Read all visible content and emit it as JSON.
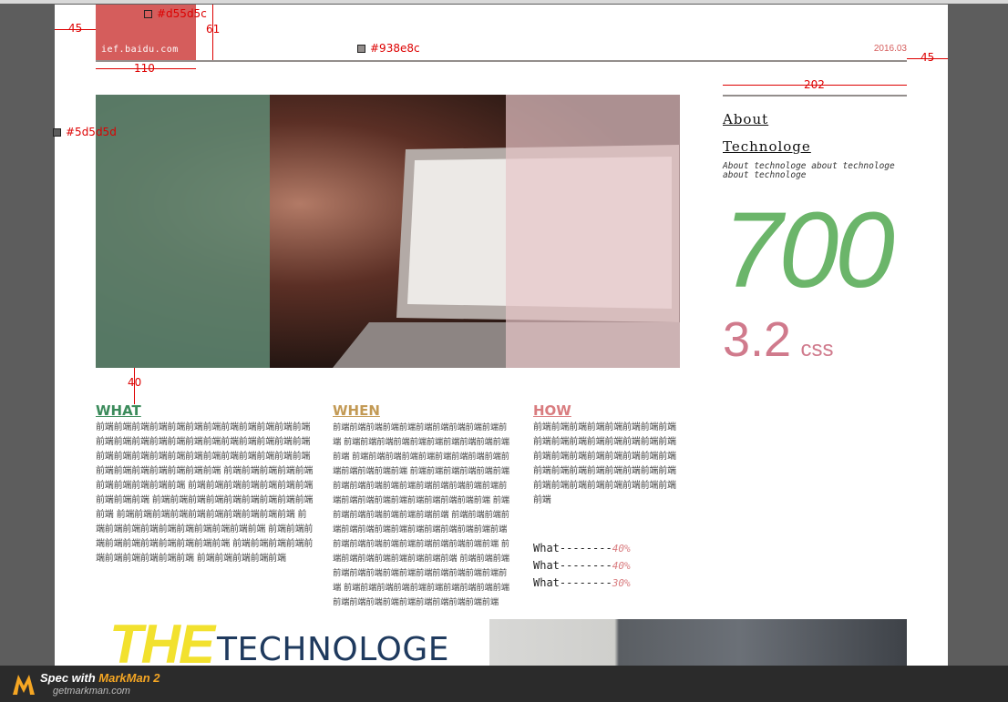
{
  "header": {
    "logo_url": "ief.baidu.com",
    "date": "2016.03"
  },
  "sidebar": {
    "title_line1": "About",
    "title_line2": "Technologe",
    "subtitle": "About technologe about technologe about technologe",
    "big_number": "700",
    "version_number": "3.2",
    "version_unit": "css"
  },
  "columns": [
    {
      "heading": "WHAT",
      "body": "前端前端前端前端前端前端前端前端前端前端前端前端前端前端前端前端前端前端前端前端前端前端前端前端前端前端前端前端前端前端前端前端前端前端前端前端前端前端前端前端前端前端前端 前端前端前端前端前端前端前端前端前端前端 前端前端前端前端前端前端前端前端前端前端 前端前端前端前端前端前端前端前端前端前端 前端前端前端前端前端前端前端前端前端前端 前端前端前端前端前端前端前端前端前端前端 前端前端前端前端前端前端前端前端前端前端 前端前端前端前端前端前端前端前端前端前端 前端前端前端前端前端"
    },
    {
      "heading": "WHEN",
      "body": "前端前端前端前端前端前端前端前端前端前端前端 前端前端前端前端前端前端前端前端前端前端前端 前端前端前端前端前端前端前端前端前端前端前端前端前端前端 前端前端前端前端前端前端前端前端前端前端前端前端前端前端前端前端前端前端前端前端前端前端前端前端前端前端 前端前端前端前端前端前端前端前端 前端前端前端前端前端前端前端前端前端前端前端前端前端前端 前端前端前端前端前端前端前端前端前端前端 前端前端前端前端前端前端前端前端 前端前端前端前端前端前端前端前端前端前端前端前端前端前端 前端前端前端前端前端前端前端前端前端前端前端前端前端前端前端前端前端前端前端前端"
    },
    {
      "heading": "HOW",
      "body": "前端前端前端前端前端前端前端前端前端前端前端前端前端前端前端前端前端前端前端前端前端前端前端前端前端前端前端前端前端前端前端前端前端前端前端前端前端前端前端前端前端"
    }
  ],
  "stats": [
    {
      "label": "What--------",
      "value": "40%"
    },
    {
      "label": "What--------",
      "value": "40%"
    },
    {
      "label": "What--------",
      "value": "30%"
    }
  ],
  "bottom": {
    "the": "THE",
    "technologe": "TECHNOLOGE"
  },
  "annotations": {
    "margin_left": "45",
    "margin_right": "45",
    "logo_width": "110",
    "logo_height": "61",
    "sidebar_width": "202",
    "hero_gap": "40",
    "color_logo": "#d55d5c",
    "color_rule": "#938e8c",
    "color_bg": "#5d5d5d"
  },
  "footer": {
    "title_prefix": "Spec with ",
    "title_brand": "MarkMan 2",
    "site": "getmarkman.com"
  },
  "colors": {
    "accent_red": "#d55d5c",
    "rule_gray": "#938e8c",
    "outer_bg": "#5d5d5d",
    "green": "#6bb56a",
    "pink": "#d07a8c"
  }
}
